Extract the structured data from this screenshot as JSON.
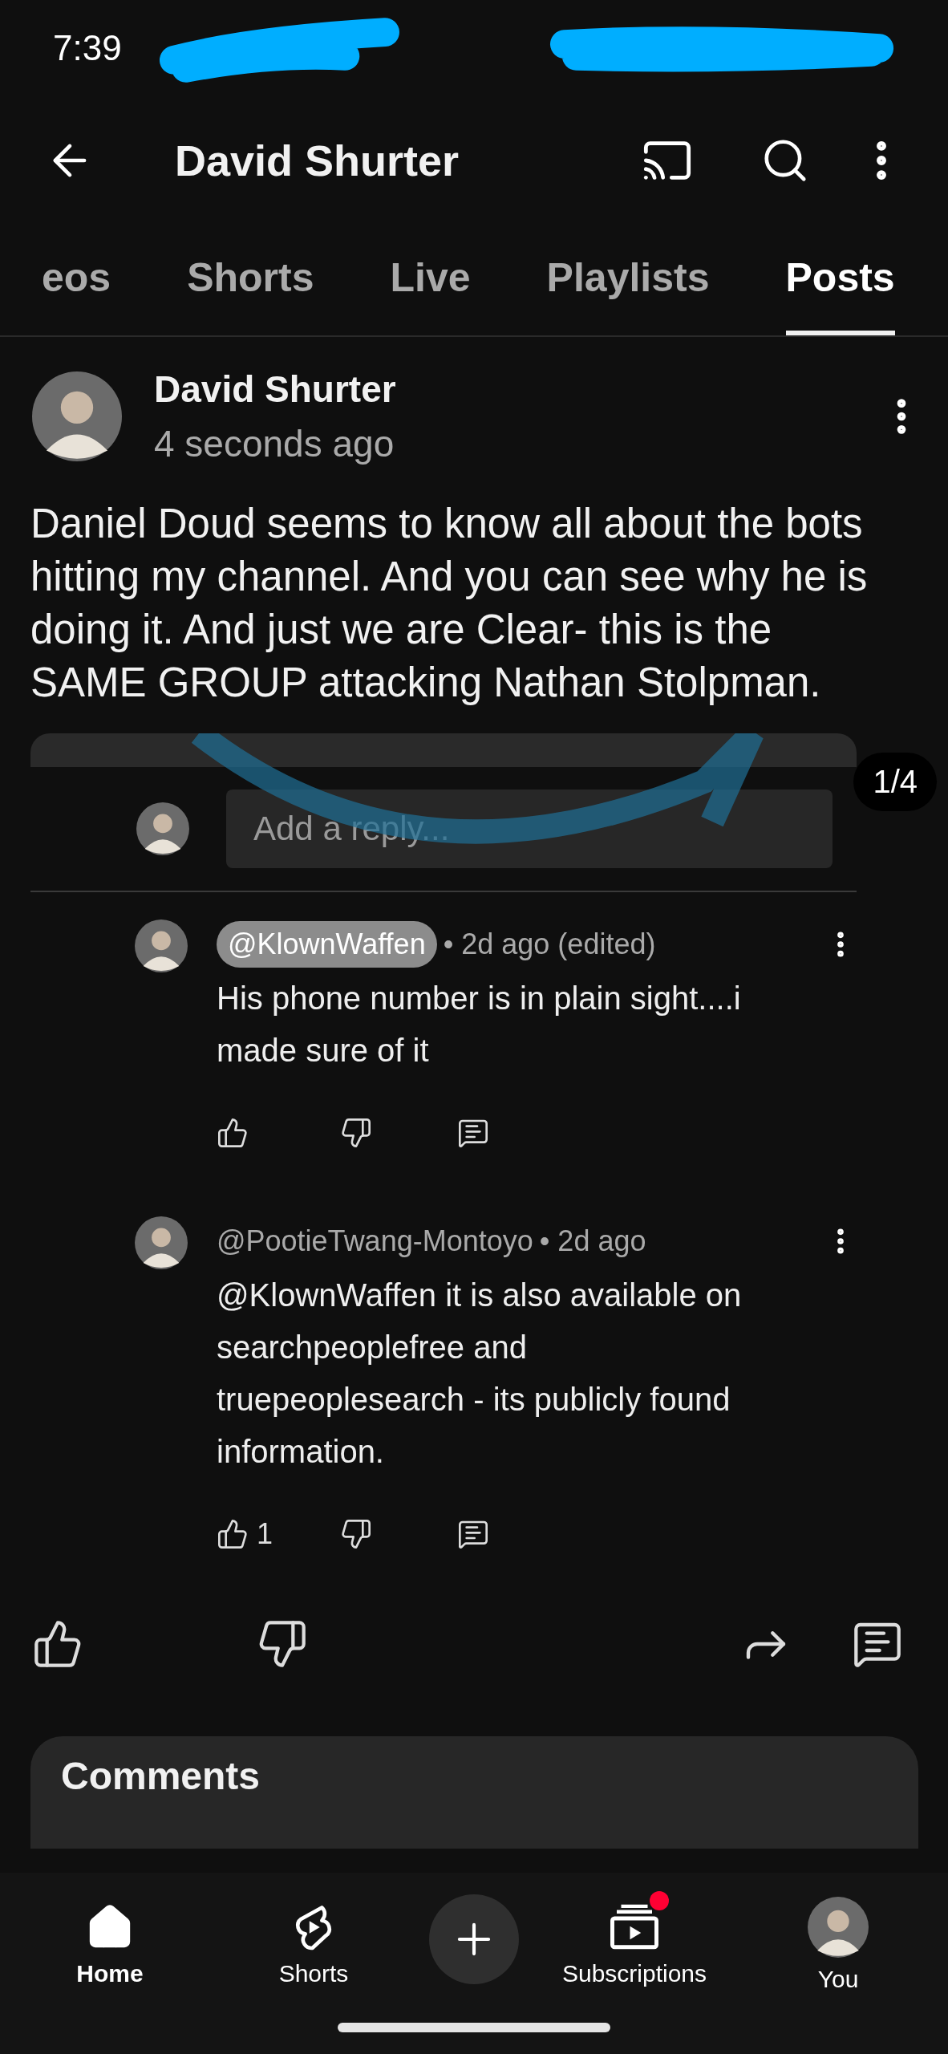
{
  "status_bar": {
    "time": "7:39"
  },
  "header": {
    "title": "David Shurter"
  },
  "tabs": [
    {
      "label": "eos",
      "selected": false
    },
    {
      "label": "Shorts",
      "selected": false
    },
    {
      "label": "Live",
      "selected": false
    },
    {
      "label": "Playlists",
      "selected": false
    },
    {
      "label": "Posts",
      "selected": true
    }
  ],
  "post": {
    "author": "David Shurter",
    "time": "4 seconds ago",
    "text": "Daniel Doud seems to know all about the bots hitting my channel. And you can see why he is doing it. And just we are Clear- this is the SAME GROUP attacking Nathan Stolpman.",
    "image": {
      "counter": "1/4",
      "reply_placeholder": "Add a reply...",
      "comments": [
        {
          "handle": "@KlownWaffen",
          "highlighted": true,
          "meta": "• 2d ago (edited)",
          "text": "His phone number is in plain sight....i made sure of it"
        },
        {
          "handle": "@PootieTwang-Montoyo",
          "highlighted": false,
          "meta": "• 2d ago",
          "text": "@KlownWaffen it is also available on searchpeoplefree and truepeoplesearch - its publicly found information.",
          "likes": "1"
        }
      ]
    },
    "section_title": "Comments"
  },
  "nav": [
    {
      "label": "Home",
      "kind": "home",
      "selected": true,
      "badge": false
    },
    {
      "label": "Shorts",
      "kind": "shorts",
      "selected": false,
      "badge": false
    },
    {
      "kind": "create"
    },
    {
      "label": "Subscriptions",
      "kind": "subscriptions",
      "selected": false,
      "badge": true
    },
    {
      "label": "You",
      "kind": "you",
      "selected": false,
      "badge": false
    }
  ]
}
